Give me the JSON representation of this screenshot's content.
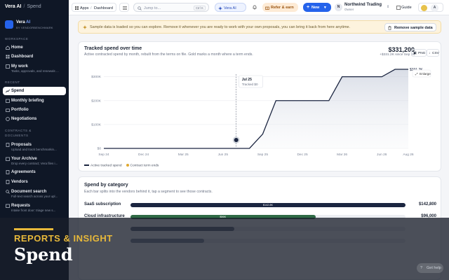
{
  "sidebar": {
    "brand": "Vera AI",
    "brand_sub": "Spend",
    "org_name": "Vera",
    "org_ai": "AI",
    "org_by": "BY VENDORBENCHMARK",
    "section_workspace": "WORKSPACE",
    "home": "Home",
    "dashboard": "Dashboard",
    "my_work": "My work",
    "my_work_desc": "Tasks, approvals, and renewals ...",
    "section_recent": "RECENT",
    "spend": "Spend",
    "monthly": "Monthly briefing",
    "portfolio": "Portfolio",
    "negotiations": "Negotiations",
    "section_contracts": "CONTRACTS &",
    "section_documents": "DOCUMENTS",
    "proposals": "Proposals",
    "proposals_desc": "Upload and track benchmarkin...",
    "archive": "Your Archive",
    "archive_desc": "Drop every contract; Vera files i...",
    "agreements": "Agreements",
    "vendors": "Vendors",
    "docsearch": "Document search",
    "docsearch_desc": "Full-text search across your upl...",
    "requests": "Requests",
    "requests_desc": "Intake front door: triage new s..."
  },
  "topbar": {
    "apps": "Apps",
    "dashboard": "Dashboard",
    "search_placeholder": "Jump to...",
    "search_kbd": "Ctrl K",
    "vera": "Vera AI",
    "refer": "Refer & earn",
    "new": "New",
    "account_avatar": "N",
    "account_name": "Northwind Trading",
    "account_role": "Owner",
    "guide": "Guide",
    "user_avatar": "A"
  },
  "banner": {
    "message": "Sample data is loaded so you can explore. Remove it whenever you are ready to work with your own proposals, you can bring it back from here anytime.",
    "remove": "Remove sample data"
  },
  "spend_chart": {
    "title": "Tracked spend over time",
    "subtitle": "Active contracted spend by month, rebuilt from the terms on file. Gold marks a month where a term ends.",
    "total": "$331,200",
    "delta": "+$331.2K since Sep 24",
    "png": "PNG",
    "csv": "CSV",
    "enlarge": "Enlarge",
    "tooltip_month": "Jul 25",
    "tooltip_value": "Tracked $0",
    "end_label": "$331.2K",
    "legend_line": "Active tracked spend",
    "legend_dot": "Contract term ends"
  },
  "chart_data": {
    "type": "area",
    "title": "Tracked spend over time",
    "x": [
      "Sep 24",
      "Oct 24",
      "Nov 24",
      "Dec 24",
      "Jan 25",
      "Feb 25",
      "Mar 25",
      "Apr 25",
      "May 25",
      "Jun 25",
      "Jul 25",
      "Aug 25",
      "Sep 25",
      "Oct 25",
      "Nov 25",
      "Dec 25",
      "Jan 26",
      "Feb 26",
      "Mar 26",
      "Apr 26",
      "May 26",
      "Jun 26",
      "Jul 26",
      "Aug 26"
    ],
    "x_tick_labels": [
      "Sep 24",
      "Dec 24",
      "Mar 25",
      "Jun 25",
      "Sep 25",
      "Dec 25",
      "Mar 26",
      "Jun 26",
      "Aug 26"
    ],
    "series": [
      {
        "values": [
          0,
          0,
          0,
          0,
          0,
          0,
          0,
          0,
          0,
          0,
          0,
          0,
          60000,
          200000,
          200000,
          200000,
          200000,
          200000,
          300000,
          300000,
          300000,
          300000,
          331200,
          331200
        ]
      }
    ],
    "y_ticks": [
      "$0",
      "$100K",
      "$200K",
      "$300K"
    ],
    "ylim": [
      0,
      340000
    ],
    "highlight_index": 10,
    "grid": true
  },
  "category": {
    "title": "Spend by category",
    "subtitle": "Each bar splits into the vendors behind it, tap a segment to see those contracts.",
    "rows": [
      {
        "name": "SaaS subscription",
        "value": "$142,800",
        "amount": 142800,
        "bar_label": "$142.8K",
        "color": "#1b2540"
      },
      {
        "name": "Cloud infrastructure",
        "value": "$96,000",
        "amount": 96000,
        "bar_label": "$96K",
        "color": "#2f6b45"
      },
      {
        "name": "",
        "value": "",
        "amount": 54000,
        "bar_label": "",
        "color": "#6b7385"
      },
      {
        "name": "",
        "value": "",
        "amount": 38400,
        "bar_label": "",
        "color": "#8a93a5"
      }
    ]
  },
  "overlay": {
    "kicker": "REPORTS & INSIGHT",
    "title": "Spend",
    "help": "Get help"
  }
}
